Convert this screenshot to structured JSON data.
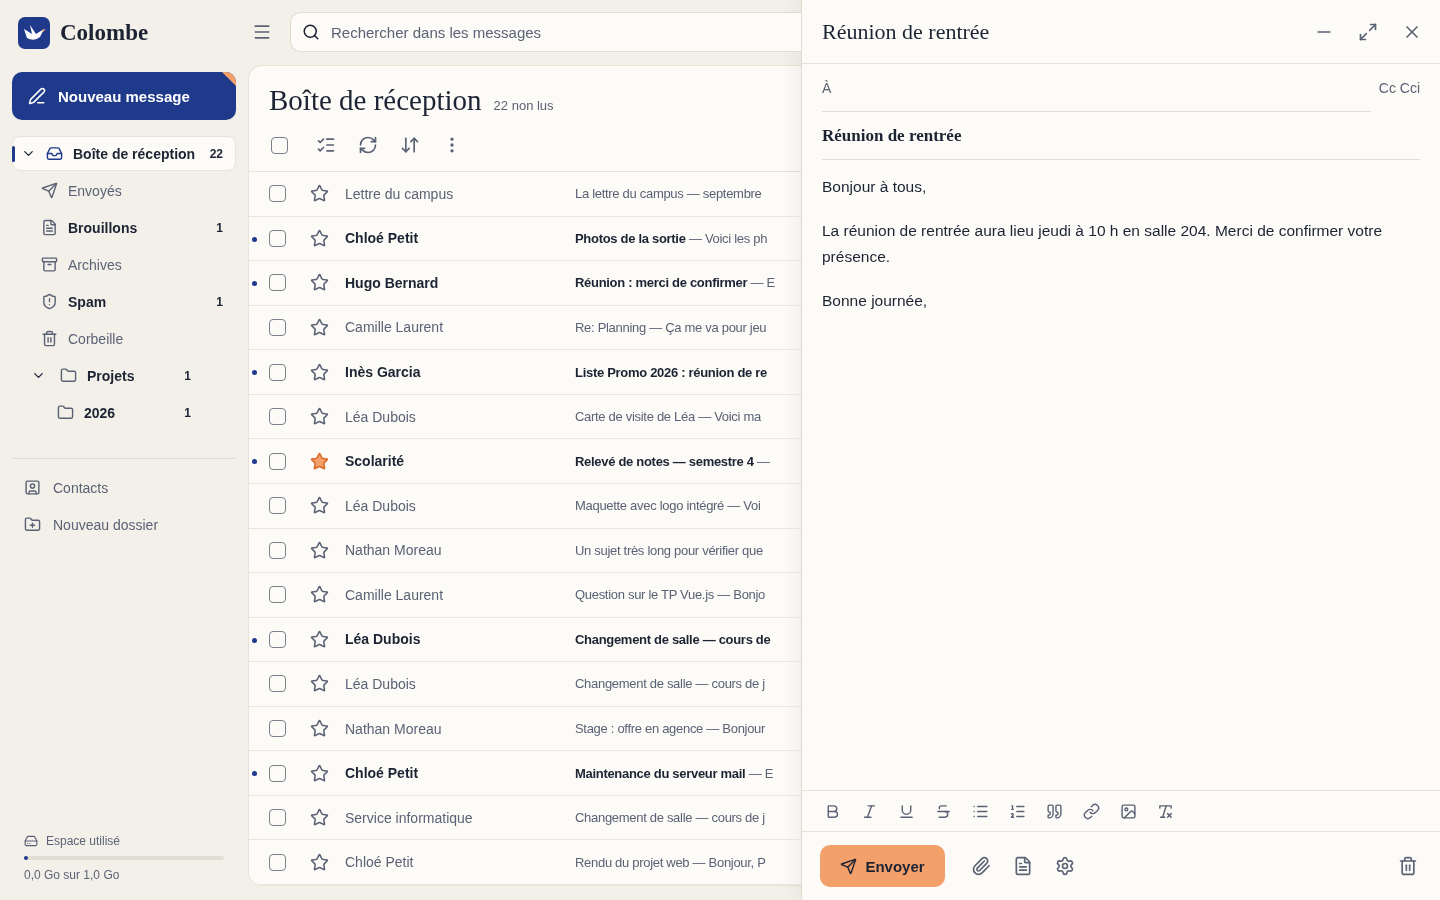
{
  "app": {
    "name": "Colombe"
  },
  "compose_button": {
    "label": "Nouveau message"
  },
  "sidebar": {
    "items": [
      {
        "label": "Boîte de réception",
        "count": "22",
        "bold": true,
        "selected": true,
        "expanded": true
      },
      {
        "label": "Envoyés",
        "bold": false,
        "selected": false
      },
      {
        "label": "Brouillons",
        "count": "1",
        "bold": true,
        "selected": false
      },
      {
        "label": "Archives",
        "bold": false,
        "selected": false
      },
      {
        "label": "Spam",
        "count": "1",
        "bold": true,
        "selected": false
      },
      {
        "label": "Corbeille",
        "bold": false,
        "selected": false
      },
      {
        "label": "Projets",
        "count": "1",
        "bold": true,
        "selected": false,
        "expanded": true,
        "children": [
          {
            "label": "2026",
            "count": "1",
            "bold": true,
            "selected": false
          }
        ]
      }
    ],
    "links": [
      {
        "label": "Contacts"
      },
      {
        "label": "Nouveau dossier"
      }
    ],
    "storage": {
      "label": "Espace utilisé",
      "level": 0.01,
      "reading": "0,0 Go sur 1,0 Go"
    }
  },
  "search": {
    "placeholder": "Rechercher dans les messages"
  },
  "inbox": {
    "title": "Boîte de réception",
    "unread": "22 non lus",
    "select_all_checked": false,
    "rows": [
      {
        "sender": "Lettre du campus",
        "subject": "La lettre du campus",
        "excerpt": "— septembre",
        "unread": false,
        "starred": false,
        "checked": false
      },
      {
        "sender": "Chloé Petit",
        "subject": "Photos de la sortie",
        "excerpt": "— Voici les ph",
        "unread": true,
        "starred": false,
        "checked": false
      },
      {
        "sender": "Hugo Bernard",
        "subject": "Réunion : merci de confirmer",
        "excerpt": "— E",
        "unread": true,
        "starred": false,
        "checked": false
      },
      {
        "sender": "Camille Laurent",
        "subject": "Re: Planning",
        "excerpt": "— Ça me va pour jeu",
        "unread": false,
        "starred": false,
        "checked": false
      },
      {
        "sender": "Inès Garcia",
        "subject": "Liste Promo 2026 : réunion de re",
        "unread": true,
        "starred": false,
        "checked": false
      },
      {
        "sender": "Léa Dubois",
        "subject": "Carte de visite de Léa",
        "excerpt": "— Voici ma",
        "unread": false,
        "starred": false,
        "checked": false
      },
      {
        "sender": "Scolarité",
        "subject": "Relevé de notes — semestre 4",
        "excerpt": "—",
        "unread": true,
        "starred": true,
        "checked": false
      },
      {
        "sender": "Léa Dubois",
        "subject": "Maquette avec logo intégré",
        "excerpt": "— Voi",
        "unread": false,
        "starred": false,
        "checked": false
      },
      {
        "sender": "Nathan Moreau",
        "subject": "Un sujet très long pour vérifier que",
        "unread": false,
        "starred": false,
        "checked": false
      },
      {
        "sender": "Camille Laurent",
        "subject": "Question sur le TP Vue.js",
        "excerpt": "— Bonjo",
        "unread": false,
        "starred": false,
        "checked": false
      },
      {
        "sender": "Léa Dubois",
        "subject": "Changement de salle — cours de",
        "unread": true,
        "starred": false,
        "checked": false
      },
      {
        "sender": "Léa Dubois",
        "subject": "Changement de salle",
        "excerpt": "— cours de j",
        "unread": false,
        "starred": false,
        "checked": false
      },
      {
        "sender": "Nathan Moreau",
        "subject": "Stage : offre en agence",
        "excerpt": "— Bonjour",
        "unread": false,
        "starred": false,
        "checked": false
      },
      {
        "sender": "Chloé Petit",
        "subject": "Maintenance du serveur mail",
        "excerpt": "— E",
        "unread": true,
        "starred": false,
        "checked": false
      },
      {
        "sender": "Service informatique",
        "subject": "Changement de salle",
        "excerpt": "— cours de j",
        "unread": false,
        "starred": false,
        "checked": false
      },
      {
        "sender": "Chloé Petit",
        "subject": "Rendu du projet web",
        "excerpt": "— Bonjour, P",
        "unread": false,
        "starred": false,
        "checked": false
      }
    ]
  },
  "compose": {
    "title": "Réunion de rentrée",
    "to_label": "À",
    "cc_label": "Cc Cci",
    "subject": "Réunion de rentrée",
    "body": [
      "Bonjour à tous,",
      "La réunion de rentrée aura lieu jeudi à 10 h en salle 204. Merci de confirmer votre présence.",
      "Bonne journée,"
    ],
    "send_label": "Envoyer"
  }
}
